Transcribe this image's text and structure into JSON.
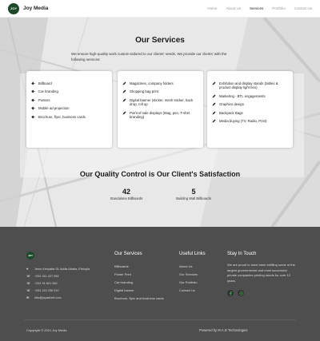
{
  "nav": {
    "brand": "Joy Media",
    "logo_text": "JOY",
    "items": [
      {
        "label": "Home",
        "active": false
      },
      {
        "label": "About Us",
        "active": false
      },
      {
        "label": "Services",
        "active": true
      },
      {
        "label": "Portfolio",
        "active": false
      },
      {
        "label": "Contact Us",
        "active": false
      }
    ]
  },
  "services": {
    "title": "Our Services",
    "intro": "We ensure high-quality work custom-tailored to our clients' needs. We provide our clients' with the following services:",
    "cards": [
      {
        "icon": "megaphone-icon",
        "items": [
          "Billboard",
          "Car branding",
          "Posters",
          "Mobile ad projection",
          "Brochure, flyer, business cards"
        ]
      },
      {
        "icon": "pen-icon",
        "items": [
          "Magazines, company folders",
          "Shopping bag print",
          "Digital banner (sticker, mesh sticker, back drop, roll up",
          "Point of sale displays (Mag, pen, T-shirt branding)"
        ]
      },
      {
        "icon": "pen-icon",
        "items": [
          "Exhibition and display stands (tables & product display light box)",
          "Marketing - BTL engagements",
          "Graphics design",
          "Backpack Bags",
          "Media buying (TV, Radio, Print)"
        ]
      }
    ]
  },
  "quality": {
    "title": "Our Quality Control is Our Client's Satisfaction",
    "stats": [
      {
        "value": "42",
        "label": "Standalone Billboards"
      },
      {
        "value": "5",
        "label": "Building Wall Billboards"
      }
    ]
  },
  "footer": {
    "logo_text": "JOY",
    "contact": [
      {
        "icon": "location-icon",
        "text": "Jemo Kenyatta St, Addis Ababa, Ethiopia"
      },
      {
        "icon": "phone-icon",
        "text": "+251 911 227 994"
      },
      {
        "icon": "phone-icon",
        "text": "+251 91 821 082"
      },
      {
        "icon": "phone-icon",
        "text": "+251 115 236 010"
      },
      {
        "icon": "mail-icon",
        "text": "info@joyadvert.com"
      }
    ],
    "services_title": "Our Services",
    "services_links": [
      "Billboards",
      "Poster Print",
      "Car branding",
      "Digital banner",
      "Brochure, flyer and business cards"
    ],
    "useful_title": "Useful Links",
    "useful_links": [
      "About Us",
      "Our Services",
      "Our Portfolio",
      "Contact Us"
    ],
    "touch_title": "Stay In Touch",
    "touch_text": "We are proud to have been fulfilling some of the largest governmental and most successful private companies printing needs for over 12 years.",
    "socials": [
      "facebook-icon",
      "whatsapp-icon"
    ],
    "copyright": "Copyright © 2021 Joy Media",
    "powered": "Powered by M.A.D Technologies"
  },
  "colors": {
    "brand_green": "#1d4a2a",
    "footer_bg": "#4e4e4e",
    "hero_bg": "#eaeaea"
  }
}
